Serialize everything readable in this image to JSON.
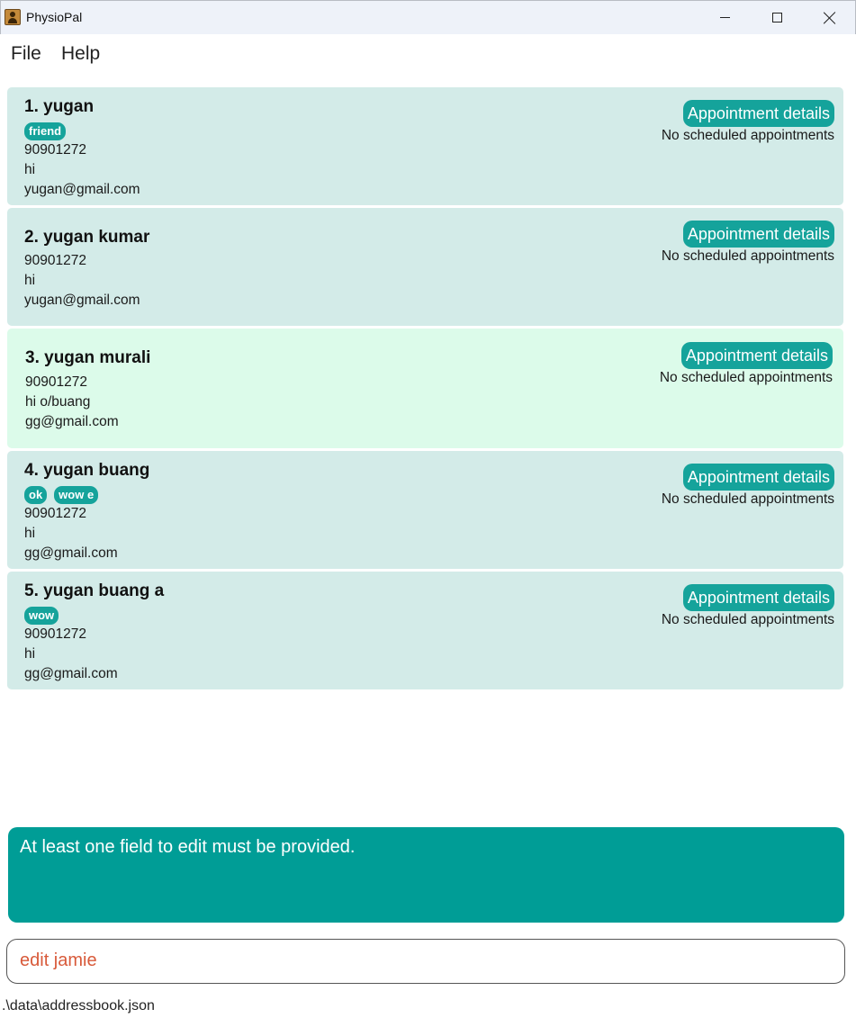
{
  "window": {
    "title": "PhysioPal"
  },
  "menu": {
    "file": "File",
    "help": "Help"
  },
  "persons": [
    {
      "index_name": "1. yugan",
      "tags": [
        "friend"
      ],
      "phone": "90901272",
      "address": "hi",
      "email": "yugan@gmail.com",
      "appointment_button": "Appointment details",
      "appointment_status": "No scheduled appointments"
    },
    {
      "index_name": "2. yugan kumar",
      "tags": [],
      "phone": "90901272",
      "address": "hi",
      "email": "yugan@gmail.com",
      "appointment_button": "Appointment details",
      "appointment_status": "No scheduled appointments"
    },
    {
      "index_name": "3. yugan murali",
      "tags": [],
      "phone": "90901272",
      "address": "hi o/buang",
      "email": "gg@gmail.com",
      "appointment_button": "Appointment details",
      "appointment_status": "No scheduled appointments",
      "selected": true
    },
    {
      "index_name": "4. yugan buang",
      "tags": [
        "ok",
        "wow e"
      ],
      "phone": "90901272",
      "address": "hi",
      "email": "gg@gmail.com",
      "appointment_button": "Appointment details",
      "appointment_status": "No scheduled appointments"
    },
    {
      "index_name": "5. yugan buang a",
      "tags": [
        "wow"
      ],
      "phone": "90901272",
      "address": "hi",
      "email": "gg@gmail.com",
      "appointment_button": "Appointment details",
      "appointment_status": "No scheduled appointments"
    }
  ],
  "result_display": {
    "message": "At least one field to edit must be provided."
  },
  "command_box": {
    "value": "edit jamie"
  },
  "status_bar": {
    "path": ".\\data\\addressbook.json"
  },
  "colors": {
    "accent": "#15a39b",
    "card_bg": "#d3ebe8",
    "card_selected_bg": "#dcfbea",
    "result_bg": "#009d96",
    "command_text": "#d85a3a"
  }
}
